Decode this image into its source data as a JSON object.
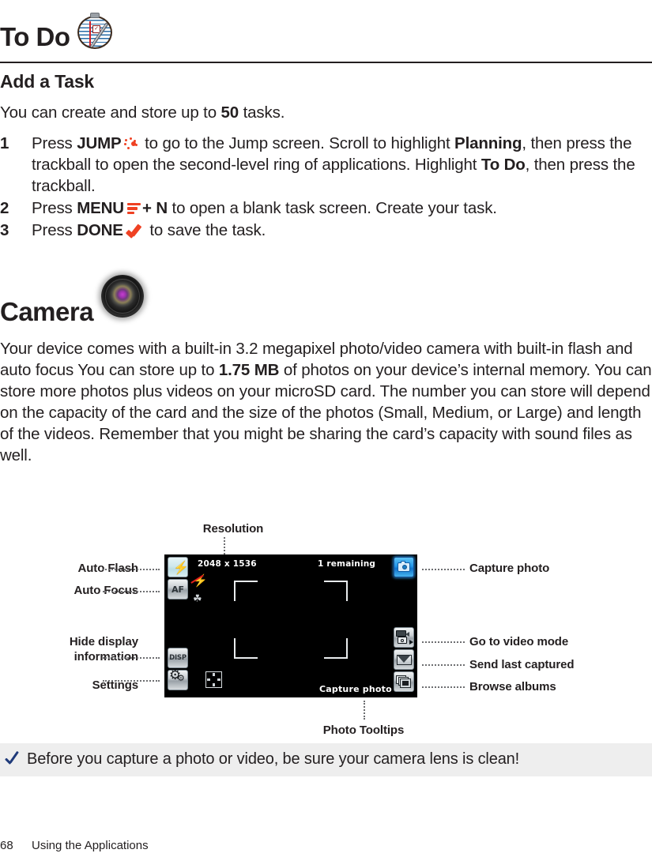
{
  "document": {
    "section_title": "To Do",
    "section_icon": "todo-notepad-icon",
    "subsection_title": "Add a Task"
  },
  "add_task": {
    "intro_pre": "You can create and store up to ",
    "intro_count": "50",
    "intro_post": " tasks.",
    "steps": [
      {
        "number": "1",
        "seg1": "Press ",
        "key1": "JUMP",
        "icon1": "jump-dots-icon",
        "seg2": " to go to the Jump screen. Scroll to highlight ",
        "bold1": "Planning",
        "seg3": ", then press the trackball to open the second-level ring of applications. Highlight ",
        "bold2": "To Do",
        "seg4": ", then press the trackball."
      },
      {
        "number": "2",
        "seg1": "Press ",
        "key1": "MENU",
        "icon1": "menu-bars-icon",
        "seg2": "+ ",
        "bold1": "N",
        "seg3": " to open a blank task screen. Create your task."
      },
      {
        "number": "3",
        "seg1": "Press ",
        "key1": "DONE",
        "icon1": "done-check-icon",
        "seg2": " to save the task."
      }
    ]
  },
  "camera": {
    "title": "Camera",
    "icon": "camera-lens-icon",
    "paragraph_pre": "Your device comes with a built-in 3.2 megapixel photo/video camera with built-in flash and auto focus You can store up to ",
    "paragraph_bold": "1.75 MB",
    "paragraph_post": " of photos on your device’s internal memory. You can store more photos plus videos on your microSD card. The number you can store will depend on the capacity of the card and the size of the photos (Small, Medium, or Large) and length of the videos. Remember that you might be sharing the card’s capacity with sound files as well."
  },
  "camera_ui": {
    "resolution_value": "2048 x 1536",
    "remaining_value": "1 remaining",
    "tooltip_value": "Capture photo",
    "buttons": {
      "flash_label": "",
      "af_label": "AF",
      "disp_label": "DISP",
      "settings_label": ""
    },
    "overlays": {
      "flash_off_icon": "flash-off-icon",
      "macro_icon": "macro-focus-icon",
      "dpad_icon": "directional-pad-icon"
    },
    "colors": {
      "screen_bg": "#000000",
      "capture_button_accent": "#2196e8",
      "flash_button_tint": "#cfe8ec",
      "button_gray": "#c9ced2"
    }
  },
  "callouts": {
    "resolution": "Resolution",
    "auto_flash": "Auto Flash",
    "auto_focus": "Auto Focus",
    "hide_display_information": "Hide display\ninformation",
    "settings": "Settings",
    "capture_photo": "Capture photo",
    "go_to_video_mode": "Go to video mode",
    "send_last_captured": "Send last captured",
    "browse_albums": "Browse albums",
    "photo_tooltips": "Photo Tooltips"
  },
  "tip": {
    "icon": "blue-checkmark-icon",
    "text": "Before you capture a photo or video, be sure your camera lens is clean!",
    "background_color": "#eeeeee",
    "check_color": "#1f3a7a"
  },
  "footer": {
    "page_number": "68",
    "running_head": "Using the Applications"
  }
}
